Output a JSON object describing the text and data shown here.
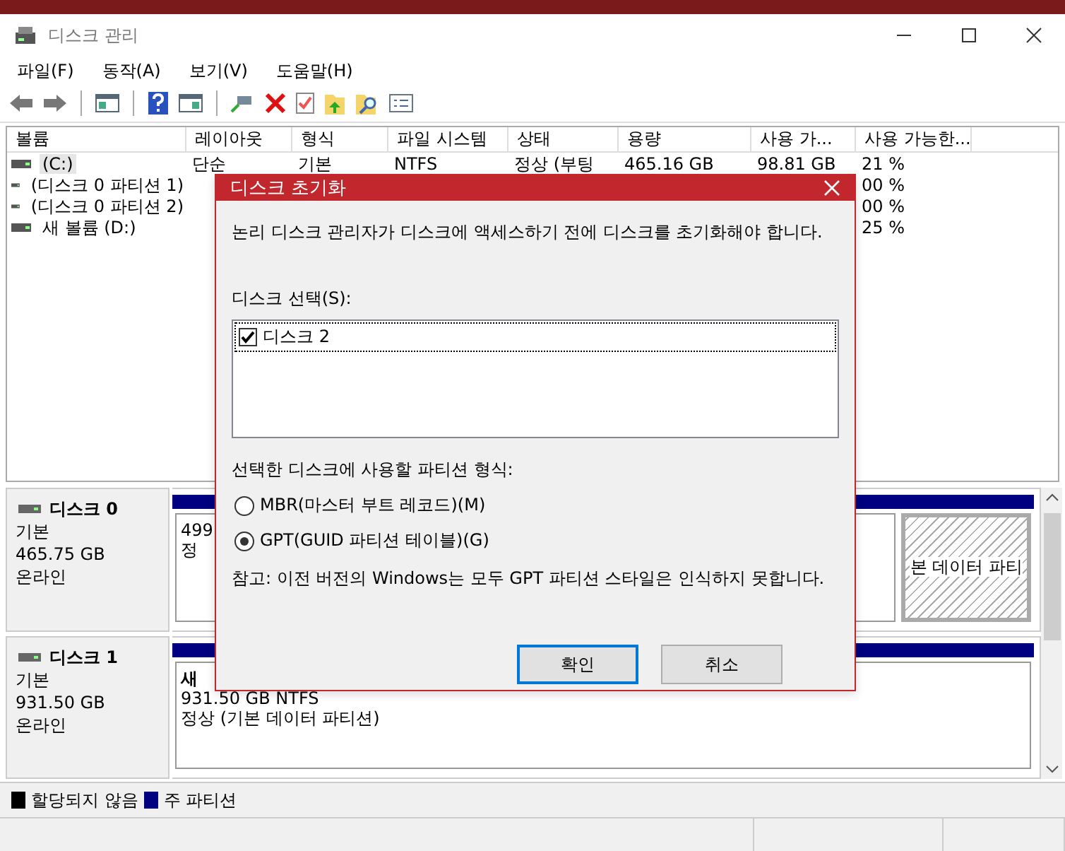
{
  "window": {
    "title": "디스크 관리"
  },
  "menu": [
    {
      "label": "파일(F)"
    },
    {
      "label": "동작(A)"
    },
    {
      "label": "보기(V)"
    },
    {
      "label": "도움말(H)"
    }
  ],
  "table": {
    "columns": [
      "볼륨",
      "레이아웃",
      "형식",
      "파일 시스템",
      "상태",
      "용량",
      "사용 가...",
      "사용 가능한..."
    ],
    "rows": [
      {
        "volume": "(C:)",
        "selected": true,
        "layout": "단순",
        "type": "기본",
        "file_system": "NTFS",
        "status": "정상 (부팅",
        "capacity": "465.16 GB",
        "free_space": "98.81 GB",
        "percent_free": "21 %"
      },
      {
        "volume": "(디스크 0 파티션 1)",
        "selected": false,
        "percent_free": "00 %"
      },
      {
        "volume": "(디스크 0 파티션 2)",
        "selected": false,
        "percent_free": "00 %"
      },
      {
        "volume": "새 볼륨 (D:)",
        "selected": false,
        "percent_free": "25 %"
      }
    ]
  },
  "disks": [
    {
      "name": "디스크 0",
      "type": "기본",
      "size": "465.75 GB",
      "status": "온라인",
      "partitions": [
        {
          "lines": [
            "499",
            "정"
          ],
          "selected": false
        },
        {
          "lines": [
            "본 데이터 파티"
          ],
          "selected": true
        }
      ]
    },
    {
      "name": "디스크 1",
      "type": "기본",
      "size": "931.50 GB",
      "status": "온라인",
      "partitions": [
        {
          "name": "새",
          "lines": [
            "931.50 GB NTFS",
            "정상 (기본 데이터 파티션)"
          ],
          "selected": false
        }
      ]
    }
  ],
  "legend": [
    {
      "label": "할당되지 않음",
      "color": "#000000"
    },
    {
      "label": "주 파티션",
      "color": "#000080"
    }
  ],
  "dialog": {
    "title": "디스크 초기화",
    "message": "논리 디스크 관리자가 디스크에 액세스하기 전에 디스크를 초기화해야 합니다.",
    "select_label": "디스크 선택(S):",
    "disks": [
      {
        "label": "디스크 2",
        "checked": true,
        "selected": true
      }
    ],
    "style_label": "선택한 디스크에 사용할 파티션 형식:",
    "styles": [
      {
        "label": "MBR(마스터 부트 레코드)(M)",
        "selected": false
      },
      {
        "label": "GPT(GUID 파티션 테이블)(G)",
        "selected": true
      }
    ],
    "note": "참고: 이전 버전의 Windows는 모두 GPT 파티션 스타일은 인식하지 못합니다.",
    "buttons": [
      {
        "label": "확인",
        "default": true
      },
      {
        "label": "취소",
        "default": false
      }
    ]
  }
}
